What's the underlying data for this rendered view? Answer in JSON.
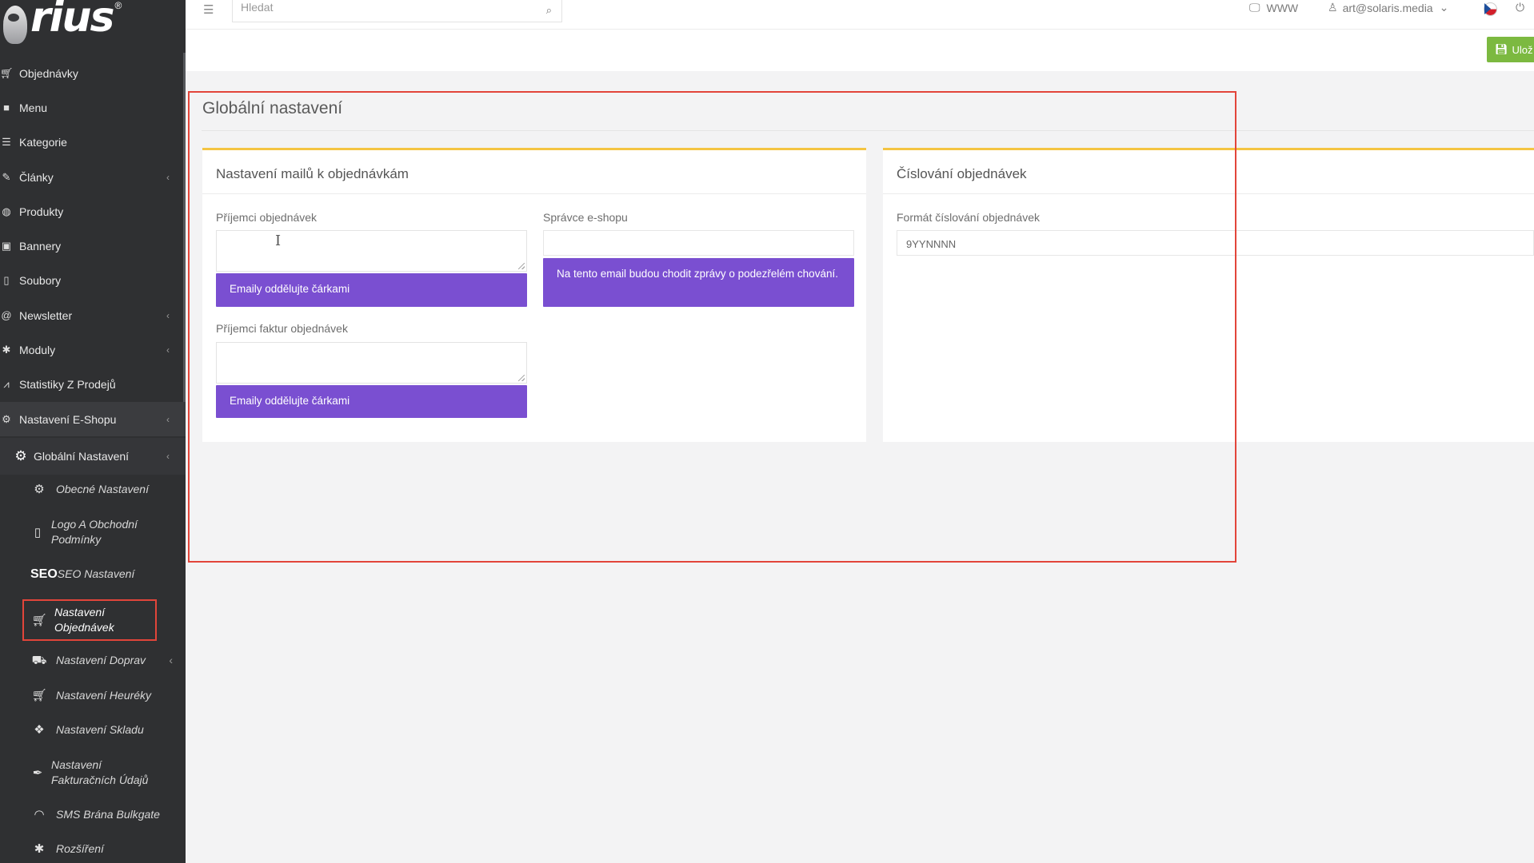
{
  "logo": {
    "text": "rius",
    "reg": "®"
  },
  "topbar": {
    "search_placeholder": "Hledat",
    "www_label": "WWW",
    "user_email": "art@solaris.media"
  },
  "toolbar": {
    "save_label": "Ulož"
  },
  "sidebar": {
    "items": [
      {
        "label": "Objednávky",
        "icon": "cart-icon"
      },
      {
        "label": "Menu",
        "icon": "folder-icon"
      },
      {
        "label": "Kategorie",
        "icon": "list-icon"
      },
      {
        "label": "Články",
        "icon": "pencil-icon",
        "chevron": true
      },
      {
        "label": "Produkty",
        "icon": "globe-icon"
      },
      {
        "label": "Bannery",
        "icon": "image-icon"
      },
      {
        "label": "Soubory",
        "icon": "file-icon"
      },
      {
        "label": "Newsletter",
        "icon": "at-icon",
        "chevron": true
      },
      {
        "label": "Moduly",
        "icon": "puzzle-icon",
        "chevron": true
      },
      {
        "label": "Statistiky Z Prodejů",
        "icon": "chart-line-icon"
      },
      {
        "label": "Nastavení E-Shopu",
        "icon": "settings-icon",
        "chevron": true
      }
    ],
    "global": {
      "label": "Globální Nastavení"
    },
    "subitems": {
      "obecne": "Obecné Nastavení",
      "logo_line1": "Logo A Obchodní",
      "logo_line2": "Podmínky",
      "seo_icon": "SEO",
      "seo": "SEO Nastavení",
      "orders_line1": "Nastavení",
      "orders_line2": "Objednávek",
      "dopravy": "Nastavení Doprav",
      "heureky": "Nastavení Heuréky",
      "skladu": "Nastavení Skladu",
      "fakt_line1": "Nastavení",
      "fakt_line2": "Fakturačních Údajů",
      "sms": "SMS Brána Bulkgate",
      "rozsireni": "Rozšíření"
    }
  },
  "page": {
    "title": "Globální nastavení",
    "panel_mail": {
      "title": "Nastavení mailů k objednávkám",
      "recipients_label": "Příjemci objednávek",
      "recipients_value": "",
      "recipients_hint": "Emaily oddělujte čárkami",
      "admin_label": "Správce e-shopu",
      "admin_value": "",
      "admin_hint": "Na tento email budou chodit zprávy o podezřelém chování.",
      "invoice_label": "Příjemci faktur objednávek",
      "invoice_value": "",
      "invoice_hint": "Emaily oddělujte čárkami"
    },
    "panel_numbering": {
      "title": "Číslování objednávek",
      "format_label": "Formát číslování objednávek",
      "format_value": "9YYNNNN"
    }
  },
  "colors": {
    "sidebar_bg": "#2f3032",
    "hint_purple": "#7a4fd1",
    "panel_accent": "#f4c442",
    "save_green": "#7cb940",
    "highlight_red": "#e2453a"
  }
}
